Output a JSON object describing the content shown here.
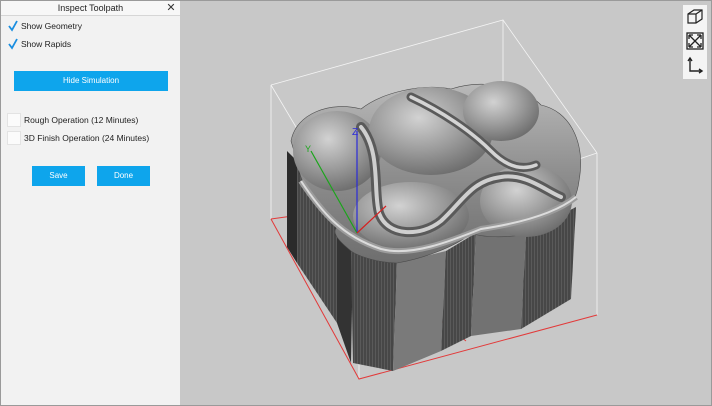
{
  "panel": {
    "title": "Inspect Toolpath",
    "close_icon": "close-icon",
    "show_geometry": {
      "label": "Show Geometry",
      "checked": true
    },
    "show_rapids": {
      "label": "Show Rapids",
      "checked": true
    },
    "hide_simulation_label": "Hide Simulation",
    "operations": [
      {
        "label": "Rough Operation  (12 Minutes)"
      },
      {
        "label": "3D Finish Operation  (24 Minutes)"
      }
    ],
    "save_label": "Save",
    "done_label": "Done"
  },
  "viewport": {
    "background": "#c8c8c8",
    "axes": {
      "x": "X",
      "y": "Y",
      "z": "Z"
    },
    "tools": [
      "cube-view-icon",
      "fit-view-icon",
      "axis-view-icon"
    ]
  },
  "colors": {
    "accent": "#0ea5ec",
    "stock_box": "#ffffff",
    "floor_lines": "#e23a3a"
  }
}
